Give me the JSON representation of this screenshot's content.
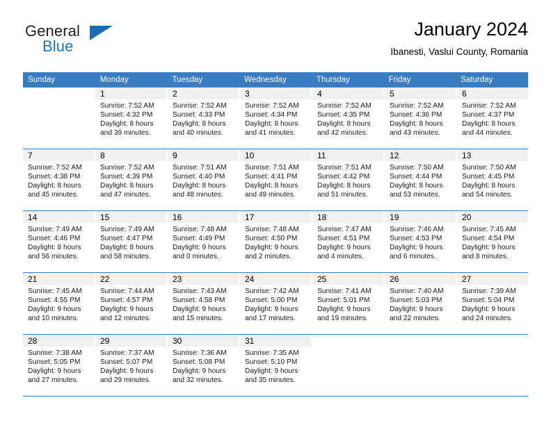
{
  "brand": {
    "name_part1": "General",
    "name_part2": "Blue",
    "accent_color": "#1b75bb"
  },
  "header": {
    "title": "January 2024",
    "subtitle": "Ibanesti, Vaslui County, Romania"
  },
  "calendar": {
    "header_color": "#3a7cc0",
    "day_names": [
      "Sunday",
      "Monday",
      "Tuesday",
      "Wednesday",
      "Thursday",
      "Friday",
      "Saturday"
    ],
    "weeks": [
      [
        {
          "day": "",
          "sunrise": "",
          "sunset": "",
          "daylight1": "",
          "daylight2": ""
        },
        {
          "day": "1",
          "sunrise": "Sunrise: 7:52 AM",
          "sunset": "Sunset: 4:32 PM",
          "daylight1": "Daylight: 8 hours",
          "daylight2": "and 39 minutes."
        },
        {
          "day": "2",
          "sunrise": "Sunrise: 7:52 AM",
          "sunset": "Sunset: 4:33 PM",
          "daylight1": "Daylight: 8 hours",
          "daylight2": "and 40 minutes."
        },
        {
          "day": "3",
          "sunrise": "Sunrise: 7:52 AM",
          "sunset": "Sunset: 4:34 PM",
          "daylight1": "Daylight: 8 hours",
          "daylight2": "and 41 minutes."
        },
        {
          "day": "4",
          "sunrise": "Sunrise: 7:52 AM",
          "sunset": "Sunset: 4:35 PM",
          "daylight1": "Daylight: 8 hours",
          "daylight2": "and 42 minutes."
        },
        {
          "day": "5",
          "sunrise": "Sunrise: 7:52 AM",
          "sunset": "Sunset: 4:36 PM",
          "daylight1": "Daylight: 8 hours",
          "daylight2": "and 43 minutes."
        },
        {
          "day": "6",
          "sunrise": "Sunrise: 7:52 AM",
          "sunset": "Sunset: 4:37 PM",
          "daylight1": "Daylight: 8 hours",
          "daylight2": "and 44 minutes."
        }
      ],
      [
        {
          "day": "7",
          "sunrise": "Sunrise: 7:52 AM",
          "sunset": "Sunset: 4:38 PM",
          "daylight1": "Daylight: 8 hours",
          "daylight2": "and 45 minutes."
        },
        {
          "day": "8",
          "sunrise": "Sunrise: 7:52 AM",
          "sunset": "Sunset: 4:39 PM",
          "daylight1": "Daylight: 8 hours",
          "daylight2": "and 47 minutes."
        },
        {
          "day": "9",
          "sunrise": "Sunrise: 7:51 AM",
          "sunset": "Sunset: 4:40 PM",
          "daylight1": "Daylight: 8 hours",
          "daylight2": "and 48 minutes."
        },
        {
          "day": "10",
          "sunrise": "Sunrise: 7:51 AM",
          "sunset": "Sunset: 4:41 PM",
          "daylight1": "Daylight: 8 hours",
          "daylight2": "and 49 minutes."
        },
        {
          "day": "11",
          "sunrise": "Sunrise: 7:51 AM",
          "sunset": "Sunset: 4:42 PM",
          "daylight1": "Daylight: 8 hours",
          "daylight2": "and 51 minutes."
        },
        {
          "day": "12",
          "sunrise": "Sunrise: 7:50 AM",
          "sunset": "Sunset: 4:44 PM",
          "daylight1": "Daylight: 8 hours",
          "daylight2": "and 53 minutes."
        },
        {
          "day": "13",
          "sunrise": "Sunrise: 7:50 AM",
          "sunset": "Sunset: 4:45 PM",
          "daylight1": "Daylight: 8 hours",
          "daylight2": "and 54 minutes."
        }
      ],
      [
        {
          "day": "14",
          "sunrise": "Sunrise: 7:49 AM",
          "sunset": "Sunset: 4:46 PM",
          "daylight1": "Daylight: 8 hours",
          "daylight2": "and 56 minutes."
        },
        {
          "day": "15",
          "sunrise": "Sunrise: 7:49 AM",
          "sunset": "Sunset: 4:47 PM",
          "daylight1": "Daylight: 8 hours",
          "daylight2": "and 58 minutes."
        },
        {
          "day": "16",
          "sunrise": "Sunrise: 7:48 AM",
          "sunset": "Sunset: 4:49 PM",
          "daylight1": "Daylight: 9 hours",
          "daylight2": "and 0 minutes."
        },
        {
          "day": "17",
          "sunrise": "Sunrise: 7:48 AM",
          "sunset": "Sunset: 4:50 PM",
          "daylight1": "Daylight: 9 hours",
          "daylight2": "and 2 minutes."
        },
        {
          "day": "18",
          "sunrise": "Sunrise: 7:47 AM",
          "sunset": "Sunset: 4:51 PM",
          "daylight1": "Daylight: 9 hours",
          "daylight2": "and 4 minutes."
        },
        {
          "day": "19",
          "sunrise": "Sunrise: 7:46 AM",
          "sunset": "Sunset: 4:53 PM",
          "daylight1": "Daylight: 9 hours",
          "daylight2": "and 6 minutes."
        },
        {
          "day": "20",
          "sunrise": "Sunrise: 7:45 AM",
          "sunset": "Sunset: 4:54 PM",
          "daylight1": "Daylight: 9 hours",
          "daylight2": "and 8 minutes."
        }
      ],
      [
        {
          "day": "21",
          "sunrise": "Sunrise: 7:45 AM",
          "sunset": "Sunset: 4:55 PM",
          "daylight1": "Daylight: 9 hours",
          "daylight2": "and 10 minutes."
        },
        {
          "day": "22",
          "sunrise": "Sunrise: 7:44 AM",
          "sunset": "Sunset: 4:57 PM",
          "daylight1": "Daylight: 9 hours",
          "daylight2": "and 12 minutes."
        },
        {
          "day": "23",
          "sunrise": "Sunrise: 7:43 AM",
          "sunset": "Sunset: 4:58 PM",
          "daylight1": "Daylight: 9 hours",
          "daylight2": "and 15 minutes."
        },
        {
          "day": "24",
          "sunrise": "Sunrise: 7:42 AM",
          "sunset": "Sunset: 5:00 PM",
          "daylight1": "Daylight: 9 hours",
          "daylight2": "and 17 minutes."
        },
        {
          "day": "25",
          "sunrise": "Sunrise: 7:41 AM",
          "sunset": "Sunset: 5:01 PM",
          "daylight1": "Daylight: 9 hours",
          "daylight2": "and 19 minutes."
        },
        {
          "day": "26",
          "sunrise": "Sunrise: 7:40 AM",
          "sunset": "Sunset: 5:03 PM",
          "daylight1": "Daylight: 9 hours",
          "daylight2": "and 22 minutes."
        },
        {
          "day": "27",
          "sunrise": "Sunrise: 7:39 AM",
          "sunset": "Sunset: 5:04 PM",
          "daylight1": "Daylight: 9 hours",
          "daylight2": "and 24 minutes."
        }
      ],
      [
        {
          "day": "28",
          "sunrise": "Sunrise: 7:38 AM",
          "sunset": "Sunset: 5:05 PM",
          "daylight1": "Daylight: 9 hours",
          "daylight2": "and 27 minutes."
        },
        {
          "day": "29",
          "sunrise": "Sunrise: 7:37 AM",
          "sunset": "Sunset: 5:07 PM",
          "daylight1": "Daylight: 9 hours",
          "daylight2": "and 29 minutes."
        },
        {
          "day": "30",
          "sunrise": "Sunrise: 7:36 AM",
          "sunset": "Sunset: 5:08 PM",
          "daylight1": "Daylight: 9 hours",
          "daylight2": "and 32 minutes."
        },
        {
          "day": "31",
          "sunrise": "Sunrise: 7:35 AM",
          "sunset": "Sunset: 5:10 PM",
          "daylight1": "Daylight: 9 hours",
          "daylight2": "and 35 minutes."
        },
        {
          "day": "",
          "sunrise": "",
          "sunset": "",
          "daylight1": "",
          "daylight2": ""
        },
        {
          "day": "",
          "sunrise": "",
          "sunset": "",
          "daylight1": "",
          "daylight2": ""
        },
        {
          "day": "",
          "sunrise": "",
          "sunset": "",
          "daylight1": "",
          "daylight2": ""
        }
      ]
    ]
  }
}
